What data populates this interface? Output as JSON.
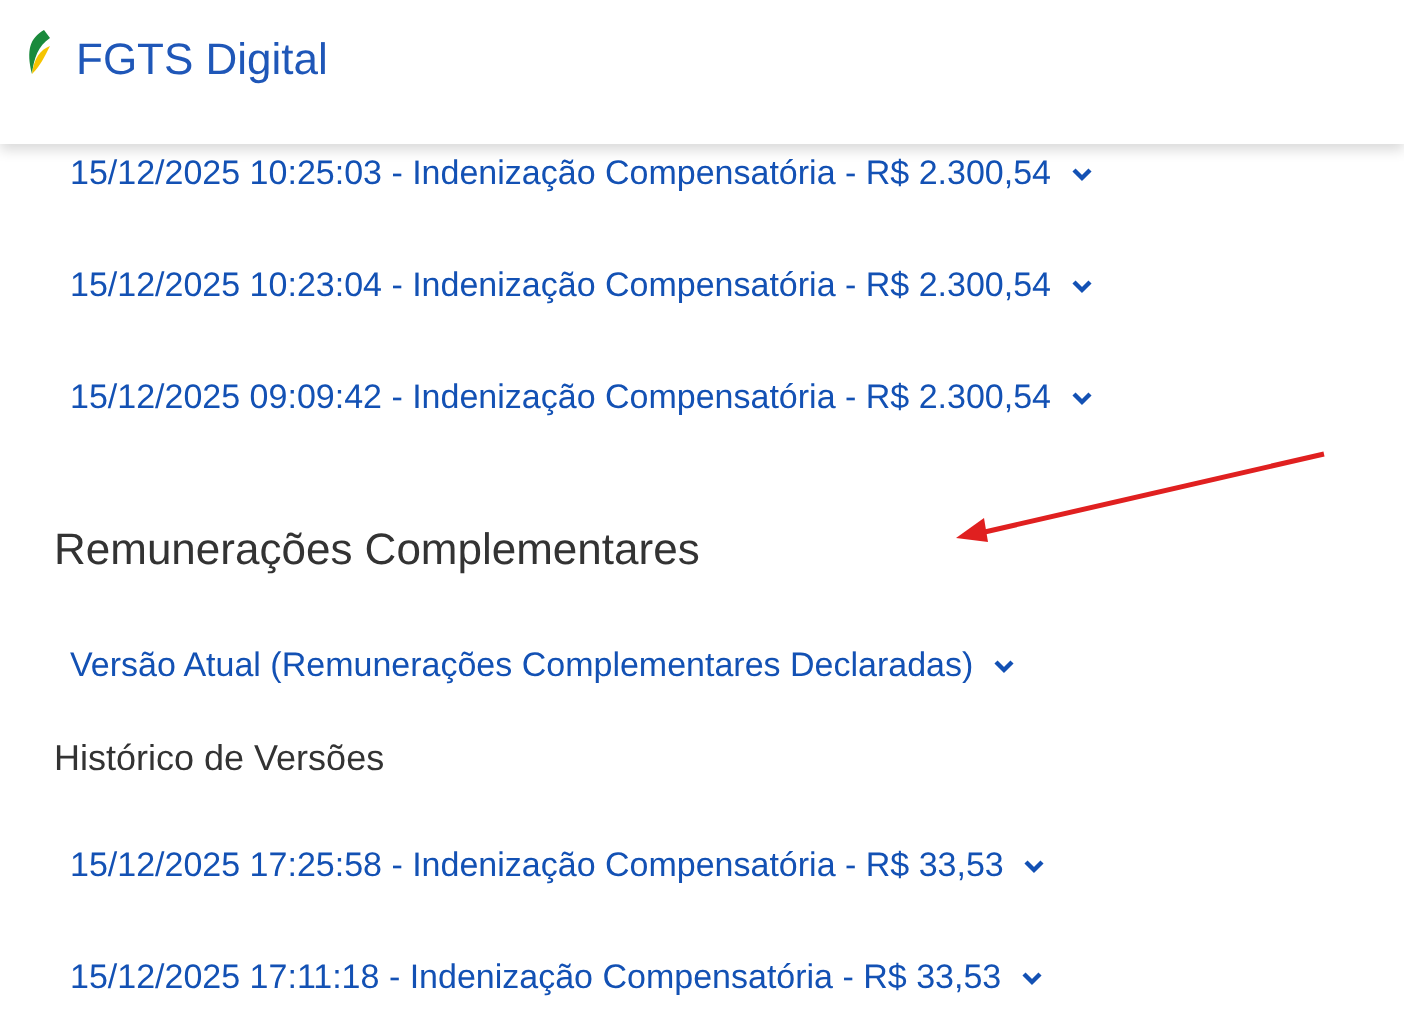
{
  "header": {
    "title": "FGTS Digital"
  },
  "previous_items": [
    {
      "label": "15/12/2025 10:25:03 - Indenização Compensatória - R$ 2.300,54"
    },
    {
      "label": "15/12/2025 10:23:04 - Indenização Compensatória - R$ 2.300,54"
    },
    {
      "label": "15/12/2025 09:09:42 - Indenização Compensatória - R$ 2.300,54"
    }
  ],
  "section": {
    "title": "Remunerações Complementares",
    "current_version": "Versão Atual (Remunerações Complementares Declaradas)",
    "history_label": "Histórico de Versões",
    "history": [
      {
        "label": "15/12/2025 17:25:58 - Indenização Compensatória - R$ 33,53"
      },
      {
        "label": "15/12/2025 17:11:18 - Indenização Compensatória - R$ 33,53"
      }
    ]
  }
}
